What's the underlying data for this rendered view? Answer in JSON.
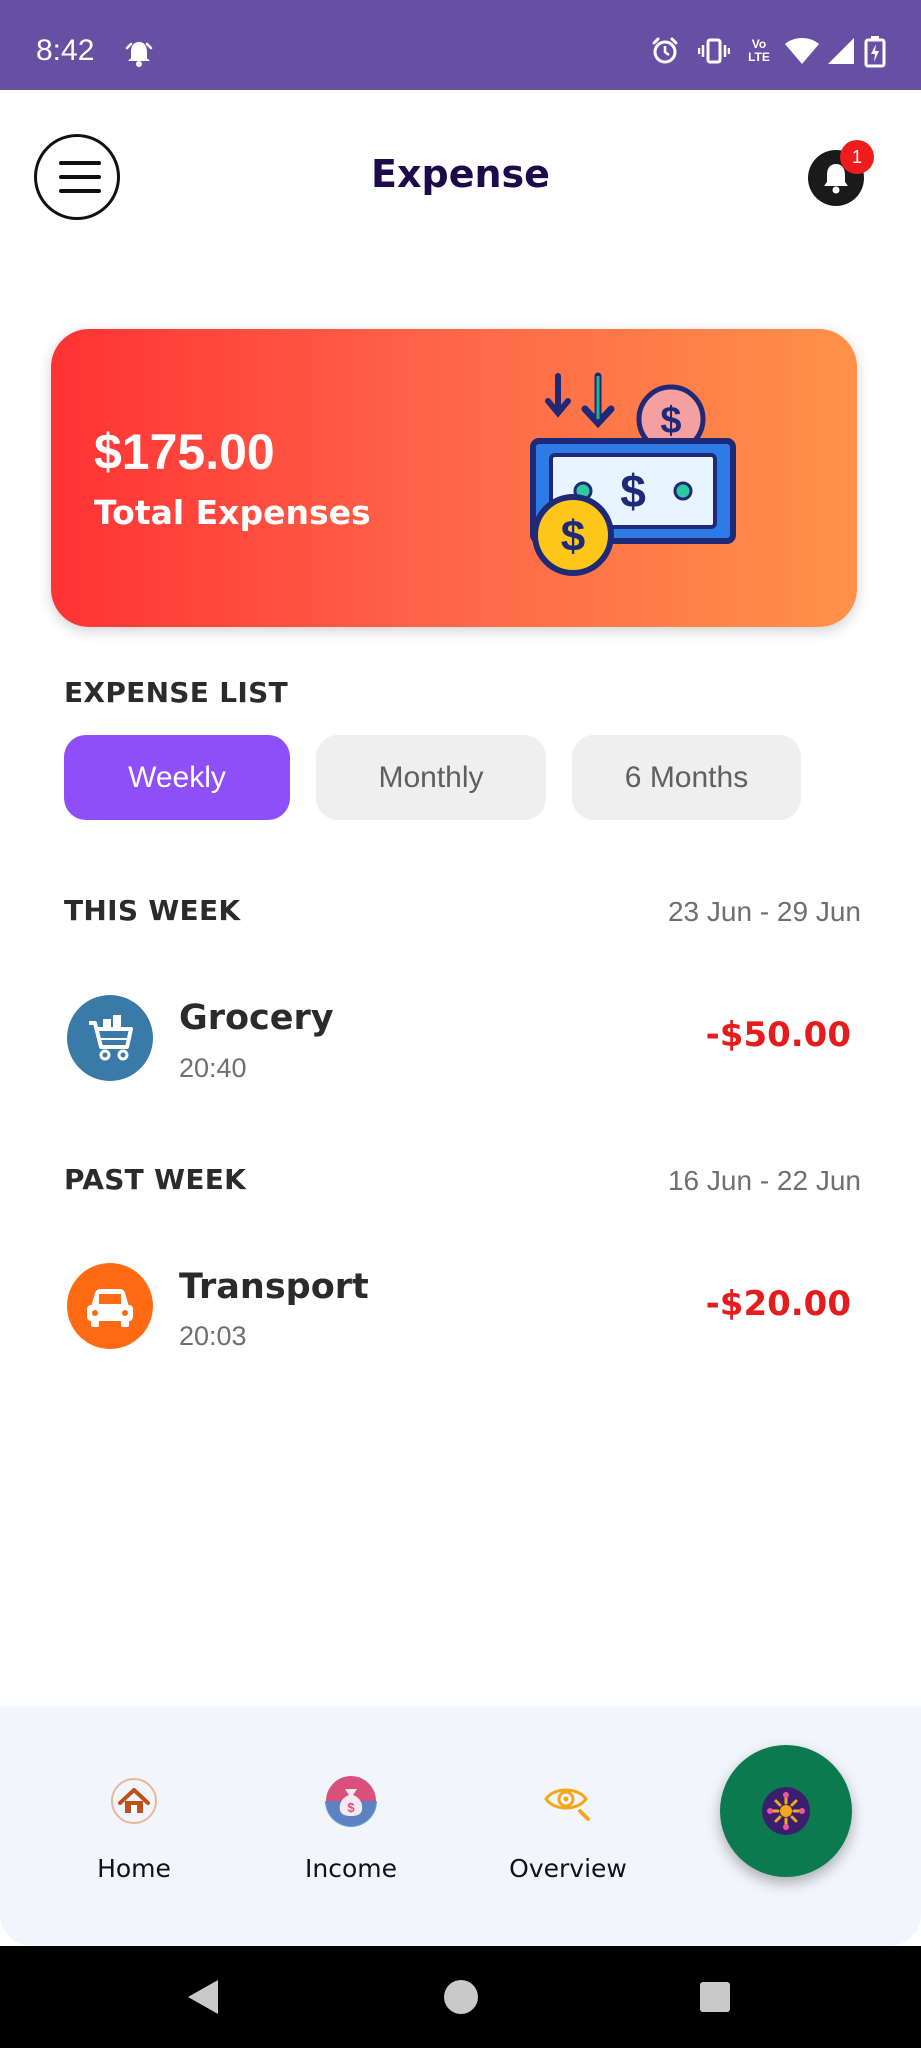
{
  "status_bar": {
    "time": "8:42",
    "network": "Vo LTE"
  },
  "header": {
    "title": "Expense",
    "notification_count": "1"
  },
  "summary": {
    "amount": "$175.00",
    "label": "Total Expenses"
  },
  "expense_list": {
    "heading": "EXPENSE LIST",
    "filters": [
      {
        "label": "Weekly",
        "active": true
      },
      {
        "label": "Monthly",
        "active": false
      },
      {
        "label": "6 Months",
        "active": false
      }
    ]
  },
  "groups": [
    {
      "title": "THIS WEEK",
      "range": "23 Jun - 29 Jun",
      "items": [
        {
          "icon": "shopping-cart-icon",
          "name": "Grocery",
          "time": "20:40",
          "amount": "-$50.00",
          "icon_color": "#3a7aa8"
        }
      ]
    },
    {
      "title": "PAST WEEK",
      "range": "16 Jun - 22 Jun",
      "items": [
        {
          "icon": "car-icon",
          "name": "Transport",
          "time": "20:03",
          "amount": "-$20.00",
          "icon_color": "#ff6a12"
        }
      ]
    }
  ],
  "bottom_nav": {
    "items": [
      {
        "icon": "home-icon",
        "label": "Home"
      },
      {
        "icon": "money-bag-icon",
        "label": "Income"
      },
      {
        "icon": "overview-eye-icon",
        "label": "Overview"
      }
    ],
    "fab_icon": "expense-add-icon"
  },
  "colors": {
    "status_bar": "#6750a4",
    "accent": "#8e4ff9",
    "expense_red": "#e61c1c",
    "fab": "#0b7a4e"
  }
}
